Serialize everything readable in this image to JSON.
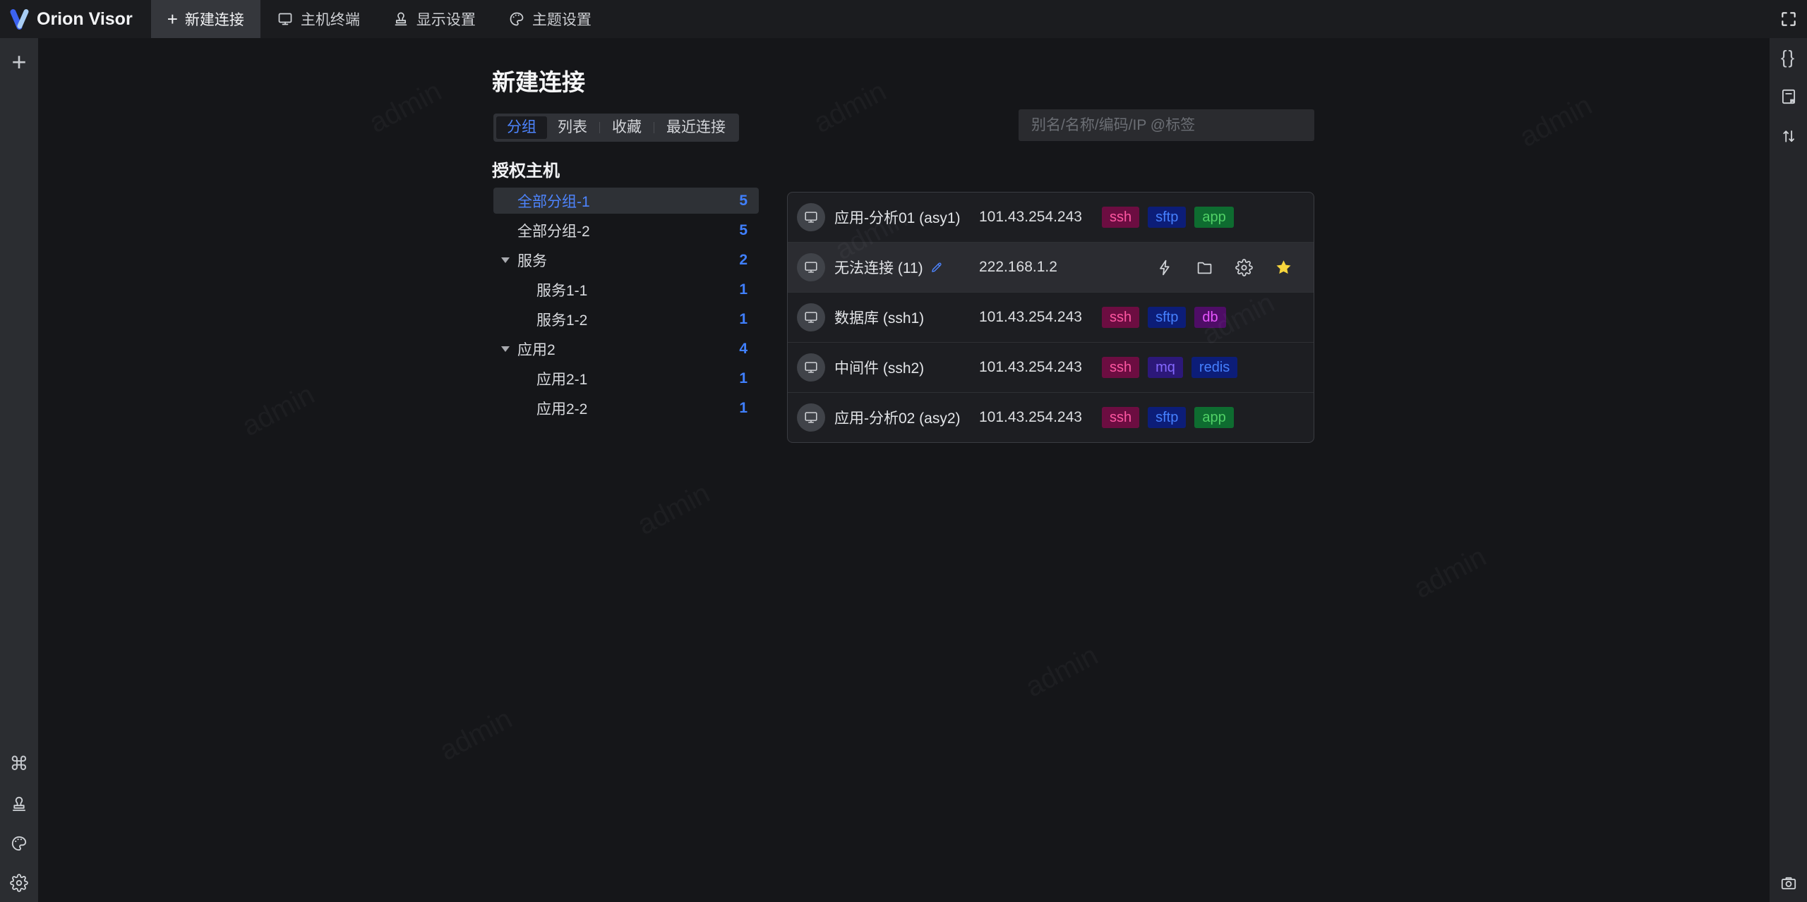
{
  "app": {
    "name": "Orion Visor"
  },
  "topbar": {
    "tabs": [
      {
        "label": "新建连接",
        "icon": "plus-icon",
        "active": true
      },
      {
        "label": "主机终端",
        "icon": "terminal-icon",
        "active": false
      },
      {
        "label": "显示设置",
        "icon": "stamp-icon",
        "active": false
      },
      {
        "label": "主题设置",
        "icon": "palette-icon",
        "active": false
      }
    ]
  },
  "page": {
    "title": "新建连接",
    "section_title": "授权主机",
    "search_placeholder": "别名/名称/编码/IP @标签",
    "view_tabs": [
      {
        "label": "分组",
        "active": true
      },
      {
        "label": "列表",
        "active": false
      },
      {
        "label": "收藏",
        "active": false
      },
      {
        "label": "最近连接",
        "active": false
      }
    ]
  },
  "tree": {
    "items": [
      {
        "label": "全部分组-1",
        "count": "5",
        "level": 1,
        "selected": true,
        "expandable": false
      },
      {
        "label": "全部分组-2",
        "count": "5",
        "level": 1,
        "selected": false,
        "expandable": false
      },
      {
        "label": "服务",
        "count": "2",
        "level": 1,
        "selected": false,
        "expandable": true
      },
      {
        "label": "服务1-1",
        "count": "1",
        "level": 2,
        "selected": false,
        "expandable": false
      },
      {
        "label": "服务1-2",
        "count": "1",
        "level": 2,
        "selected": false,
        "expandable": false
      },
      {
        "label": "应用2",
        "count": "4",
        "level": 1,
        "selected": false,
        "expandable": true
      },
      {
        "label": "应用2-1",
        "count": "1",
        "level": 2,
        "selected": false,
        "expandable": false
      },
      {
        "label": "应用2-2",
        "count": "1",
        "level": 2,
        "selected": false,
        "expandable": false
      }
    ]
  },
  "hosts": [
    {
      "name": "应用-分析01 (asy1)",
      "ip": "101.43.254.243",
      "tags": [
        {
          "label": "ssh",
          "color": "magenta"
        },
        {
          "label": "sftp",
          "color": "blue"
        },
        {
          "label": "app",
          "color": "green"
        }
      ]
    },
    {
      "name": "无法连接 (11)",
      "ip": "222.168.1.2",
      "hovered": true,
      "editable": true,
      "actions": [
        "connect",
        "sftp-folder",
        "settings",
        "favorite"
      ]
    },
    {
      "name": "数据库 (ssh1)",
      "ip": "101.43.254.243",
      "tags": [
        {
          "label": "ssh",
          "color": "magenta"
        },
        {
          "label": "sftp",
          "color": "blue"
        },
        {
          "label": "db",
          "color": "purple"
        }
      ]
    },
    {
      "name": "中间件 (ssh2)",
      "ip": "101.43.254.243",
      "tags": [
        {
          "label": "ssh",
          "color": "magenta"
        },
        {
          "label": "mq",
          "color": "violet"
        },
        {
          "label": "redis",
          "color": "blue"
        }
      ]
    },
    {
      "name": "应用-分析02 (asy2)",
      "ip": "101.43.254.243",
      "tags": [
        {
          "label": "ssh",
          "color": "magenta"
        },
        {
          "label": "sftp",
          "color": "blue"
        },
        {
          "label": "app",
          "color": "green"
        }
      ]
    }
  ],
  "icons": {
    "plus": "+",
    "command": "⌘",
    "braces": "{}"
  },
  "colors": {
    "accent": "#4d84fe",
    "count_blue": "#4080ff",
    "star_yellow": "#f7d53c",
    "topbar_bg": "#1b1c1f",
    "left_rail_bg": "#2b2d31",
    "right_rail_bg": "#25262a",
    "content_bg": "#151619",
    "list_bg": "#1d1e22",
    "hover_row_bg": "#2b2c31",
    "tags": {
      "ssh": {
        "bg": "#6c0d41",
        "fg": "#ff57a2"
      },
      "sftp": {
        "bg": "#0c1d78",
        "fg": "#4580ff"
      },
      "app": {
        "bg": "#0e6c30",
        "fg": "#50d166"
      },
      "db": {
        "bg": "#4e0d66",
        "fg": "#e855ff"
      },
      "mq": {
        "bg": "#2c1879",
        "fg": "#8468ff"
      },
      "redis": {
        "bg": "#0c1d78",
        "fg": "#4580ff"
      }
    }
  },
  "watermark": "admin"
}
